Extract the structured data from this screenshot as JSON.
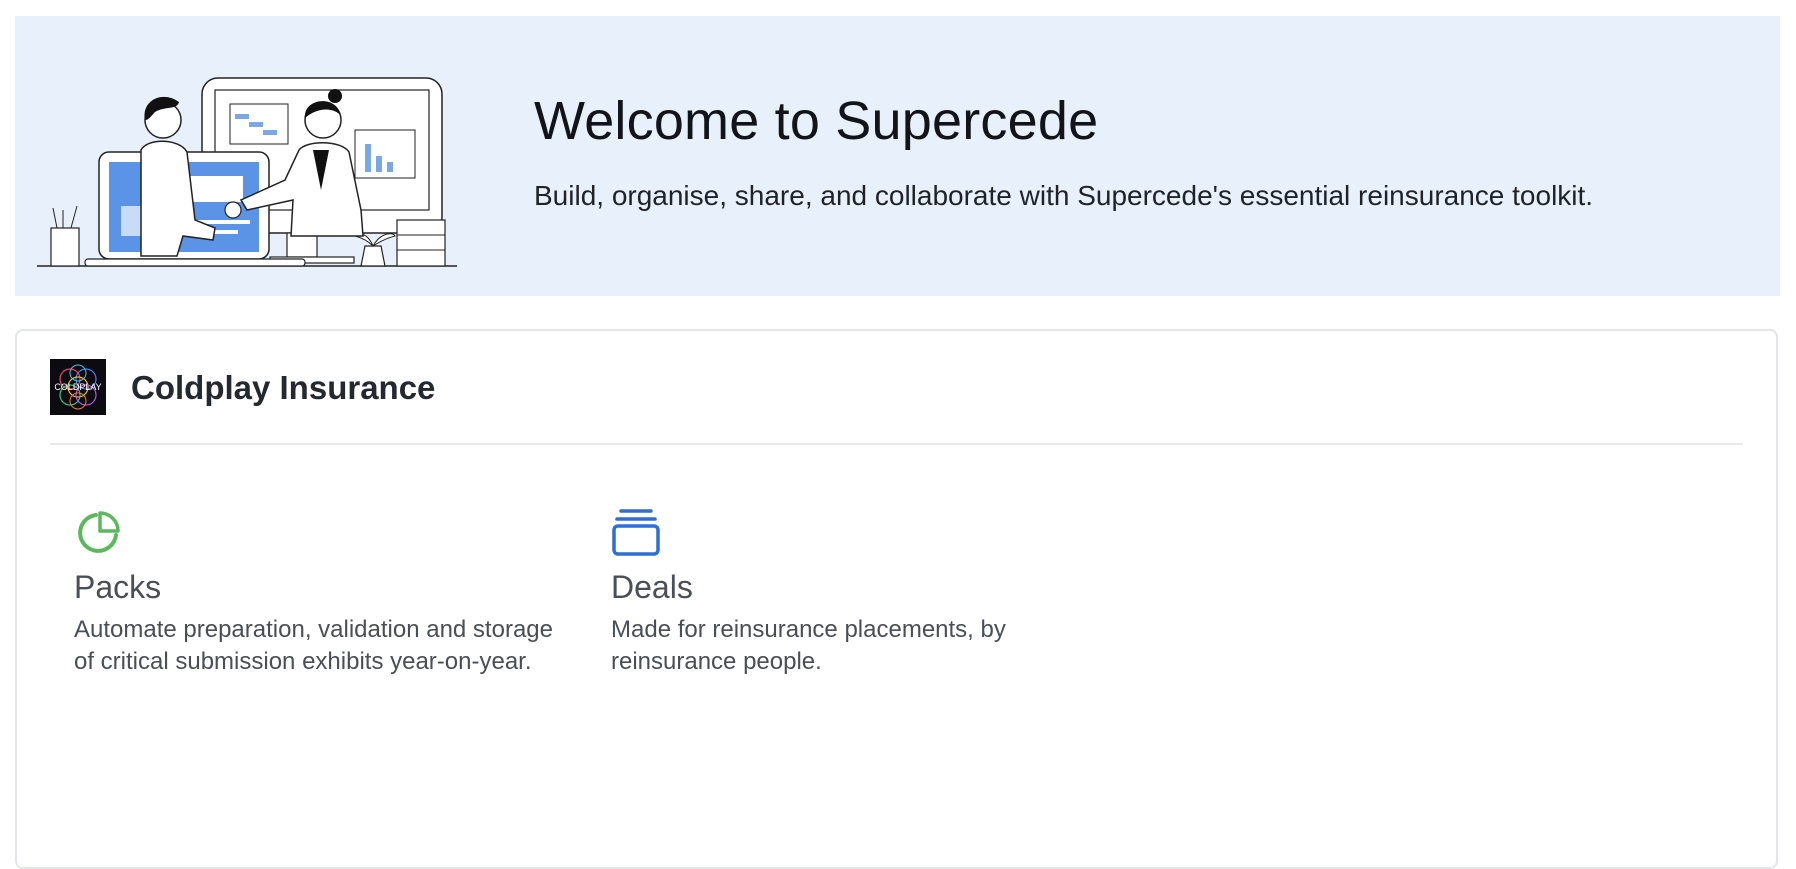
{
  "hero": {
    "title": "Welcome to Supercede",
    "subtitle": "Build, organise, share, and collaborate with Supercede's essential reinsurance toolkit.",
    "illustration_icon": "handshake-illustration",
    "background_color": "#e8f0fb"
  },
  "organization": {
    "name": "Coldplay Insurance",
    "logo_text": "COLDPLAY",
    "logo_icon": "coldplay-logo"
  },
  "products": [
    {
      "title": "Packs",
      "description": "Automate preparation, validation and storage of critical submission exhibits year-on-year.",
      "icon": "pie-chart-icon",
      "icon_color": "#5cb85c"
    },
    {
      "title": "Deals",
      "description": "Made for reinsurance placements, by reinsurance people.",
      "icon": "stacked-cards-icon",
      "icon_color": "#2f6fd1"
    }
  ]
}
